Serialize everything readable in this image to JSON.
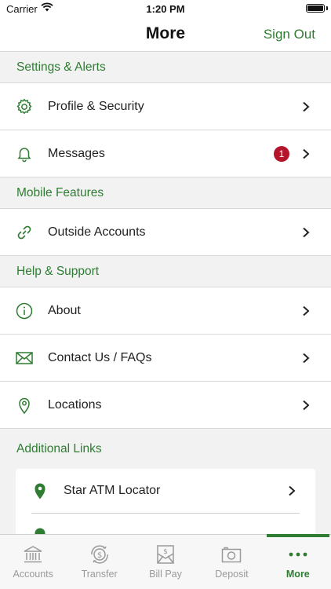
{
  "status_bar": {
    "carrier": "Carrier",
    "time": "1:20 PM"
  },
  "nav": {
    "title": "More",
    "action": "Sign Out"
  },
  "sections": {
    "settings": {
      "header": "Settings & Alerts",
      "items": [
        {
          "label": "Profile & Security",
          "icon": "gear-icon"
        },
        {
          "label": "Messages",
          "icon": "bell-icon",
          "badge": "1"
        }
      ]
    },
    "mobile": {
      "header": "Mobile Features",
      "items": [
        {
          "label": "Outside Accounts",
          "icon": "link-icon"
        }
      ]
    },
    "help": {
      "header": "Help & Support",
      "items": [
        {
          "label": "About",
          "icon": "info-icon"
        },
        {
          "label": "Contact Us / FAQs",
          "icon": "envelope-icon"
        },
        {
          "label": "Locations",
          "icon": "location-pin-icon"
        }
      ]
    },
    "links": {
      "header": "Additional Links",
      "items": [
        {
          "label": "Star ATM Locator",
          "icon": "map-pin-filled-icon"
        }
      ]
    }
  },
  "tabs": [
    {
      "label": "Accounts",
      "icon": "bank-icon"
    },
    {
      "label": "Transfer",
      "icon": "transfer-icon"
    },
    {
      "label": "Bill Pay",
      "icon": "bill-pay-icon"
    },
    {
      "label": "Deposit",
      "icon": "deposit-icon"
    },
    {
      "label": "More",
      "icon": "more-icon",
      "active": true
    }
  ],
  "colors": {
    "accent": "#2e7d32",
    "badge": "#b5152b",
    "inactive_tab": "#9a9a9a"
  }
}
